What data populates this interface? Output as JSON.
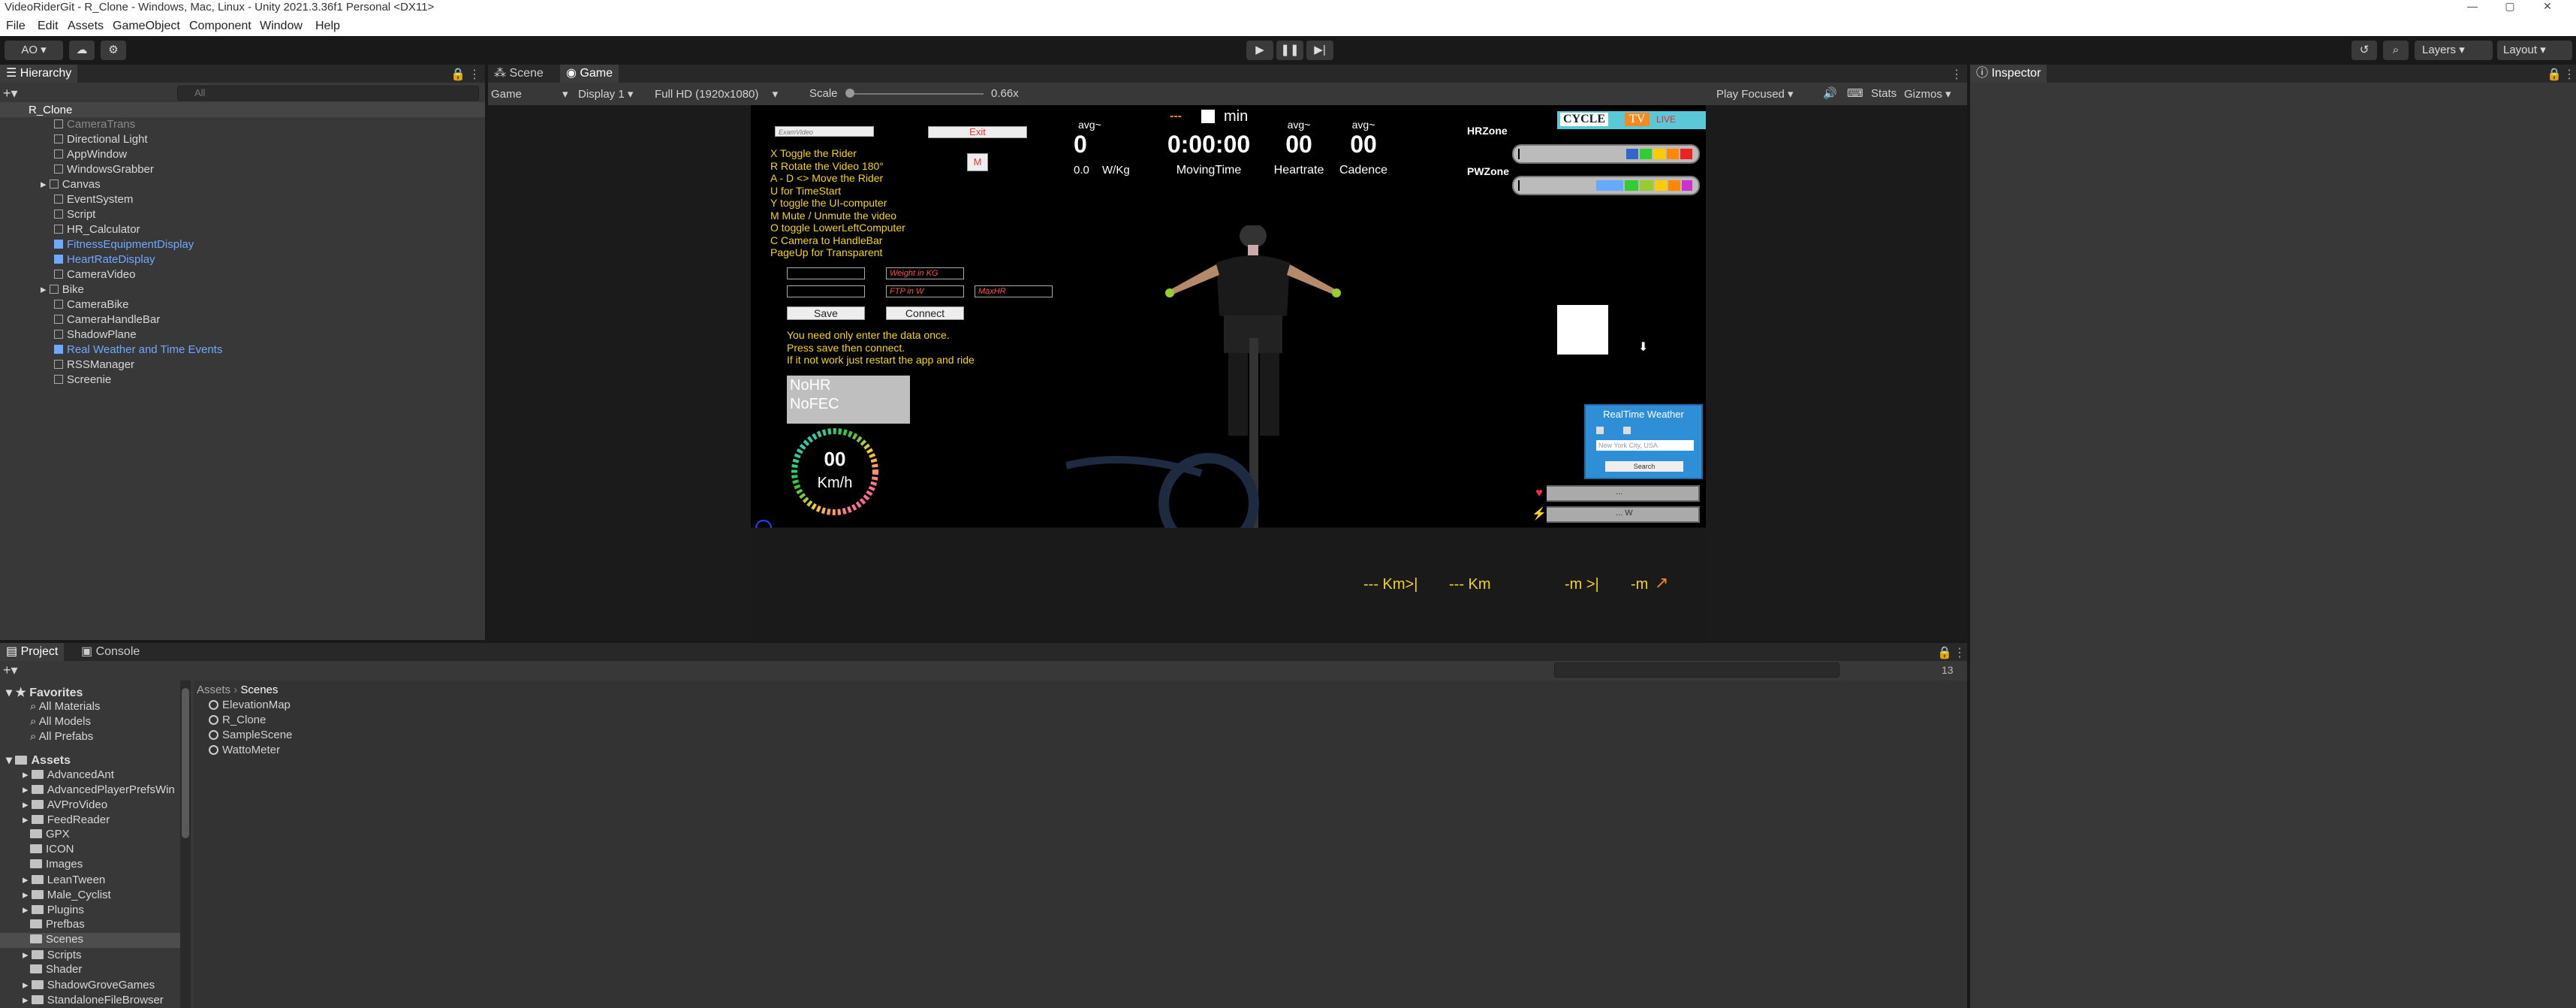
{
  "titlebar": {
    "title": "VideoRiderGit - R_Clone - Windows, Mac, Linux - Unity 2021.3.36f1 Personal <DX11>",
    "minimize": "—",
    "maximize": "▢",
    "close": "✕"
  },
  "menu": [
    "File",
    "Edit",
    "Assets",
    "GameObject",
    "Component",
    "Window",
    "Help"
  ],
  "toolbar": {
    "account": "AO ▾",
    "layers": "Layers",
    "layout": "Layout"
  },
  "hierarchy": {
    "tab": "Hierarchy",
    "search_placeholder": "All",
    "root": "R_Clone",
    "items": [
      {
        "label": "CameraTrans"
      },
      {
        "label": "Directional Light"
      },
      {
        "label": "AppWindow"
      },
      {
        "label": "WindowsGrabber"
      },
      {
        "label": "Canvas"
      },
      {
        "label": "EventSystem"
      },
      {
        "label": "Script"
      },
      {
        "label": "HR_Calculator"
      },
      {
        "label": "FitnessEquipmentDisplay"
      },
      {
        "label": "HeartRateDisplay"
      },
      {
        "label": "CameraVideo"
      },
      {
        "label": "Bike"
      },
      {
        "label": "CameraBike"
      },
      {
        "label": "CameraHandleBar"
      },
      {
        "label": "ShadowPlane"
      },
      {
        "label": "Real Weather and Time Events"
      },
      {
        "label": "RSSManager"
      },
      {
        "label": "Screenie"
      }
    ]
  },
  "scene_tabs": {
    "scene": "Scene",
    "game": "Game"
  },
  "game_toolbar": {
    "mode": "Game",
    "display": "Display 1",
    "resolution": "Full HD (1920x1080)",
    "scale_label": "Scale",
    "scale_value": "0.66x",
    "play_focused": "Play Focused",
    "stats": "Stats",
    "gizmos": "Gizmos"
  },
  "game": {
    "top_left_field": "ExamVideo",
    "exit": "Exit",
    "m_btn": "M",
    "instructions": [
      "X Toggle the Rider",
      "R Rotate the Video 180°",
      "A - D <> Move the Rider",
      "U for TimeStart",
      "Y toggle the UI-computer",
      "M Mute / Unmute the video",
      "O toggle LowerLeftComputer",
      "C Camera to HandleBar",
      "PageUp for Transparent"
    ],
    "fields": {
      "f1": "",
      "f2": "Weight in KG",
      "f3": "",
      "f4": "FTP in W",
      "f5": "MaxHR"
    },
    "save": "Save",
    "connect": "Connect",
    "notes": [
      "You need only enter the data once.",
      "Press save then connect.",
      "If it not work just restart the app and ride"
    ],
    "nohr": "NoHR",
    "nofec": "NoFEC",
    "speed": "00",
    "speed_unit": "Km/h",
    "avg_label": "avg",
    "avg_value": "00",
    "stats": {
      "power_avg": "avg~",
      "power": "0",
      "wkg": "0.0",
      "wkg_unit": "W/Kg",
      "dashes": "---",
      "min": "min",
      "time": "0:00:00",
      "moving": "MovingTime",
      "hr_avg": "avg~",
      "hr": "00",
      "hr_label": "Heartrate",
      "cad_avg": "avg~",
      "cad": "00",
      "cad_label": "Cadence"
    },
    "hrzone": "HRZone",
    "pwzone": "PWZone",
    "logo": {
      "cycle": "CYCLE",
      "tv": "TV",
      "live": "LIVE"
    },
    "weather": {
      "title": "RealTime Weather",
      "placeholder": "New York City, USA",
      "search": "Search"
    },
    "hr_bar": "...",
    "pw_bar": "... W",
    "dist": [
      "--- Km>|",
      "--- Km",
      "-m >|",
      "-m"
    ]
  },
  "project": {
    "tab": "Project",
    "console_tab": "Console",
    "count": "13",
    "favorites_label": "Favorites",
    "favorites": [
      "All Materials",
      "All Models",
      "All Prefabs"
    ],
    "assets_label": "Assets",
    "folders": [
      "AdvancedAnt",
      "AdvancedPlayerPrefsWin",
      "AVProVideo",
      "FeedReader",
      "GPX",
      "ICON",
      "Images",
      "LeanTween",
      "Male_Cyclist",
      "Plugins",
      "Prefbas",
      "Scenes",
      "Scripts",
      "Shader",
      "ShadowGroveGames",
      "StandaloneFileBrowser"
    ],
    "breadcrumb": [
      "Assets",
      "Scenes"
    ],
    "scenes": [
      "ElevationMap",
      "R_Clone",
      "SampleScene",
      "WattoMeter"
    ]
  },
  "inspector": {
    "tab": "Inspector"
  },
  "colors": {
    "accent": "#f4d31f",
    "weather": "#2f8fd6",
    "selection": "#2c5d87"
  }
}
